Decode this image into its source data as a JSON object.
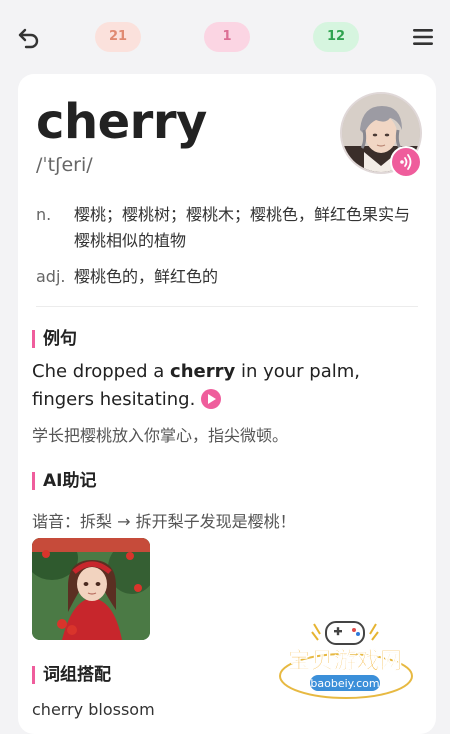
{
  "header": {
    "counters": [
      {
        "value": "21",
        "color": "#e08a72"
      },
      {
        "value": "1",
        "color": "#dc6f95"
      },
      {
        "value": "12",
        "color": "#2fa34f"
      }
    ]
  },
  "word": {
    "headword": "cherry",
    "phonetic": "/ˈtʃeri/",
    "definitions": [
      {
        "pos": "n.",
        "meaning": "樱桃；樱桃树；樱桃木；樱桃色，鲜红色果实与樱桃相似的植物"
      },
      {
        "pos": "adj.",
        "meaning": "樱桃色的，鲜红色的"
      }
    ]
  },
  "example": {
    "title": "例句",
    "en_before": "Che dropped a ",
    "en_bold": "cherry",
    "en_after": " in your palm, fingers hesitating.",
    "zh": "学长把樱桃放入你掌心，指尖微顿。"
  },
  "ai_memo": {
    "title": "AI助记",
    "text": "谐音：拆梨 → 拆开梨子发现是樱桃！"
  },
  "phrases": {
    "title": "词组搭配",
    "first": "cherry blossom"
  },
  "watermark": {
    "text": "宝贝游戏网",
    "url": "baobeiy.com"
  },
  "colors": {
    "accent": "#ef5d9c"
  }
}
